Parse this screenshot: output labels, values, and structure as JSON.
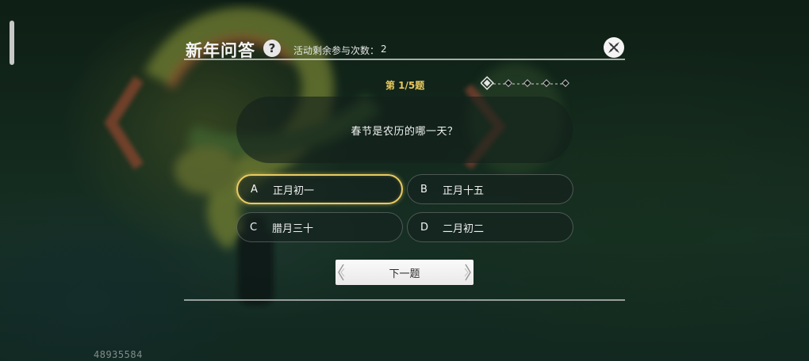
{
  "header": {
    "title": "新年问答",
    "help_icon": "question-icon",
    "remaining_label": "活动剩余参与次数：",
    "remaining_count": "2",
    "close_icon": "close-icon"
  },
  "progress": {
    "label": "第 1/5题",
    "current": 1,
    "total": 5
  },
  "question": {
    "text": "春节是农历的哪一天？"
  },
  "options": [
    {
      "letter": "A",
      "text": "正月初一",
      "selected": true
    },
    {
      "letter": "B",
      "text": "正月十五",
      "selected": false
    },
    {
      "letter": "C",
      "text": "腊月三十",
      "selected": false
    },
    {
      "letter": "D",
      "text": "二月初二",
      "selected": false
    }
  ],
  "next_button": {
    "label": "下一题"
  },
  "uid": "48935584",
  "colors": {
    "accent_gold": "#e9cb62",
    "panel_dark": "#16221e",
    "text_light": "#f2f2f2"
  }
}
